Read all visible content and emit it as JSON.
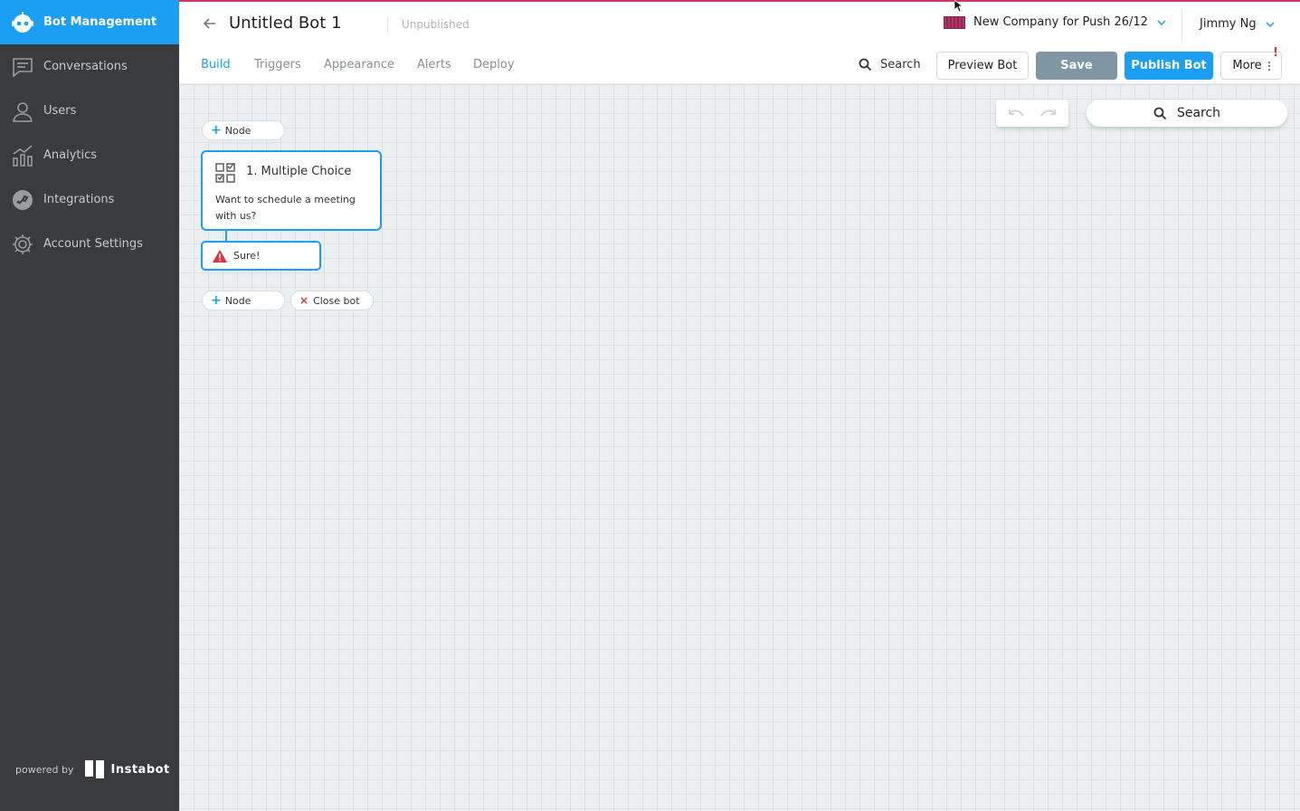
{
  "sidebar": {
    "items": [
      {
        "label": "Bot Management",
        "icon": "bot-icon",
        "active": true
      },
      {
        "label": "Conversations",
        "icon": "chat-icon",
        "active": false
      },
      {
        "label": "Users",
        "icon": "user-icon",
        "active": false
      },
      {
        "label": "Analytics",
        "icon": "analytics-icon",
        "active": false
      },
      {
        "label": "Integrations",
        "icon": "integrations-icon",
        "active": false
      },
      {
        "label": "Account Settings",
        "icon": "gear-icon",
        "active": false
      }
    ],
    "powered_by": "powered by",
    "brand": "Instabot"
  },
  "header": {
    "title": "Untitled Bot 1",
    "status": "Unpublished",
    "company": "New Company for Push 26/12",
    "user": "Jimmy Ng"
  },
  "subheader": {
    "tabs": [
      {
        "label": "Build",
        "active": true
      },
      {
        "label": "Triggers",
        "active": false
      },
      {
        "label": "Appearance",
        "active": false
      },
      {
        "label": "Alerts",
        "active": false
      },
      {
        "label": "Deploy",
        "active": false
      }
    ],
    "search_label": "Search",
    "preview_label": "Preview Bot",
    "save_label": "Save",
    "publish_label": "Publish Bot",
    "more_label": "More",
    "alert_mark": "!"
  },
  "canvas": {
    "search_label": "Search",
    "add_node_label": "Node",
    "node": {
      "title": "1. Multiple Choice",
      "text": "Want to schedule a meeting with us?",
      "icon": "multiple-choice-icon"
    },
    "choice": {
      "label": "Sure!",
      "icon": "warning-icon"
    },
    "bottom_add_node_label": "Node",
    "close_bot_label": "Close bot"
  },
  "colors": {
    "accent": "#1a9ff5",
    "sidebar_bg": "#3a3b3e",
    "save_bg": "#7f96a3",
    "warning": "#e0323c",
    "top_border": "#d6336c"
  }
}
